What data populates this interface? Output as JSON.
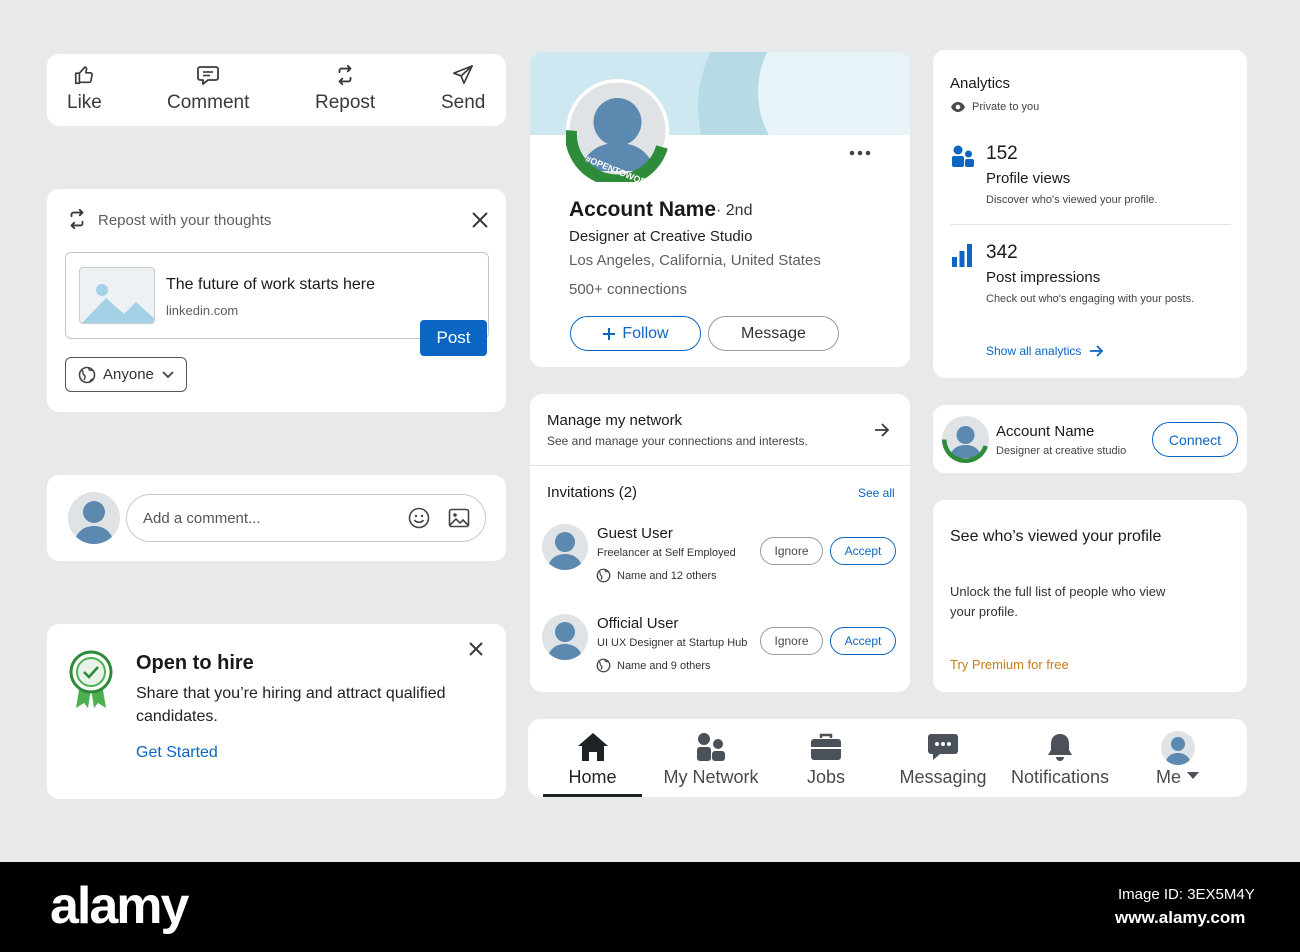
{
  "actions": {
    "like": "Like",
    "comment": "Comment",
    "repost": "Repost",
    "send": "Send"
  },
  "repost_card": {
    "header": "Repost with your thoughts",
    "preview_title": "The future of work starts here",
    "preview_source": "linkedin.com",
    "post_button": "Post",
    "audience": "Anyone"
  },
  "comment_box": {
    "placeholder": "Add a comment..."
  },
  "hire_card": {
    "title": "Open to hire",
    "body": "Share that you’re hiring and attract qualified candidates.",
    "cta": "Get Started"
  },
  "profile_card": {
    "badge_text": "#OPENTOWORK",
    "name": "Account Name",
    "degree": "· 2nd",
    "headline": "Designer at Creative Studio",
    "location": "Los Angeles, California, United States",
    "connections": "500+ connections",
    "follow": "Follow",
    "message": "Message"
  },
  "network_card": {
    "title": "Manage my network",
    "subtitle": "See and manage your connections and interests.",
    "invitations_label": "Invitations (2)",
    "see_all": "See all",
    "invitations": [
      {
        "name": "Guest User",
        "headline": "Freelancer at Self Employed",
        "mutual": "Name and 12 others",
        "ignore": "Ignore",
        "accept": "Accept"
      },
      {
        "name": "Official User",
        "headline": "UI UX Designer at Startup Hub",
        "mutual": "Name and 9 others",
        "ignore": "Ignore",
        "accept": "Accept"
      }
    ]
  },
  "analytics_card": {
    "title": "Analytics",
    "privacy": "Private to you",
    "metrics": [
      {
        "value": "152",
        "label": "Profile views",
        "desc": "Discover who's viewed your profile."
      },
      {
        "value": "342",
        "label": "Post impressions",
        "desc": "Check out who's engaging with your posts."
      }
    ],
    "show_all": "Show all analytics"
  },
  "connect_card": {
    "name": "Account Name",
    "headline": "Designer at creative studio",
    "button": "Connect"
  },
  "premium_card": {
    "title": "See who’s viewed your profile",
    "body": "Unlock the full list of people who view your profile.",
    "cta": "Try Premium for free"
  },
  "bottom_nav": {
    "items": [
      "Home",
      "My Network",
      "Jobs",
      "Messaging",
      "Notifications",
      "Me"
    ],
    "active": "Home"
  },
  "footer": {
    "logo": "alamy",
    "image_id": "Image ID: 3EX5M4Y",
    "url": "www.alamy.com"
  },
  "colors": {
    "accent": "#0a66c2",
    "premium": "#c37d16",
    "green": "#2e8b3a",
    "background": "#e8e9ea"
  }
}
